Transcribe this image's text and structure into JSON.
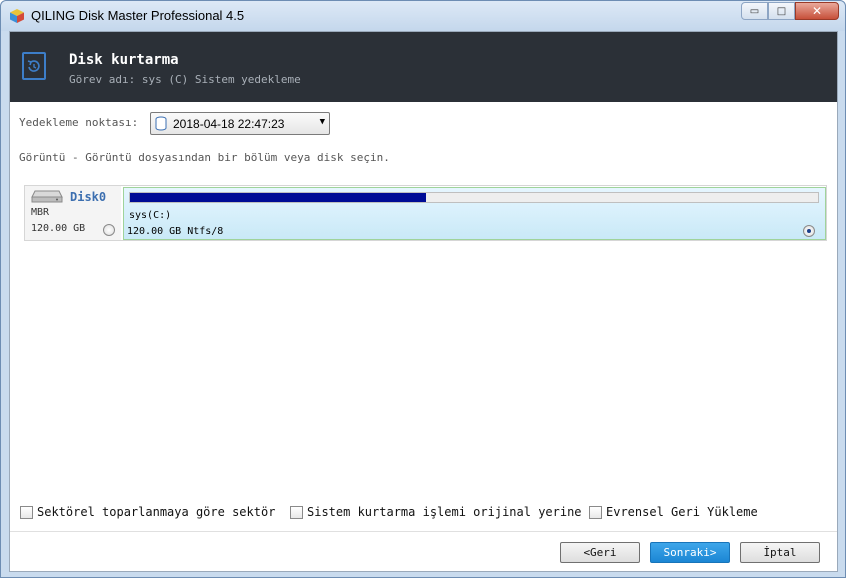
{
  "window": {
    "title": "QILING Disk Master Professional 4.5",
    "controls": {
      "minimize": "▭",
      "maximize": "□",
      "close": "✕"
    }
  },
  "header": {
    "title": "Disk kurtarma",
    "subtitle": "Görev adı:  sys (C) Sistem yedekleme",
    "icon": "restore-icon",
    "accent": "#3d7ec9"
  },
  "backup_point": {
    "label": "Yedekleme noktası:",
    "selected": "2018-04-18 22:47:23",
    "icon": "database-icon"
  },
  "hint": "Görüntü - Görüntü dosyasından bir bölüm veya disk seçin.",
  "disk": {
    "name": "Disk0",
    "type": "MBR",
    "size": "120.00 GB",
    "selected": false,
    "partition": {
      "name": "sys(C:)",
      "detail": "120.00 GB Ntfs/8",
      "used_fraction": 0.43,
      "selected": true,
      "bar_color": "#000c96"
    }
  },
  "options": [
    {
      "label": "Sektörel toparlanmaya göre sektör",
      "checked": false
    },
    {
      "label": "Sistem kurtarma işlemi orijinal yerine",
      "checked": false
    },
    {
      "label": "Evrensel Geri Yükleme",
      "checked": false
    }
  ],
  "buttons": {
    "back": "<Geri",
    "next": "Sonraki>",
    "cancel": "İptal"
  }
}
